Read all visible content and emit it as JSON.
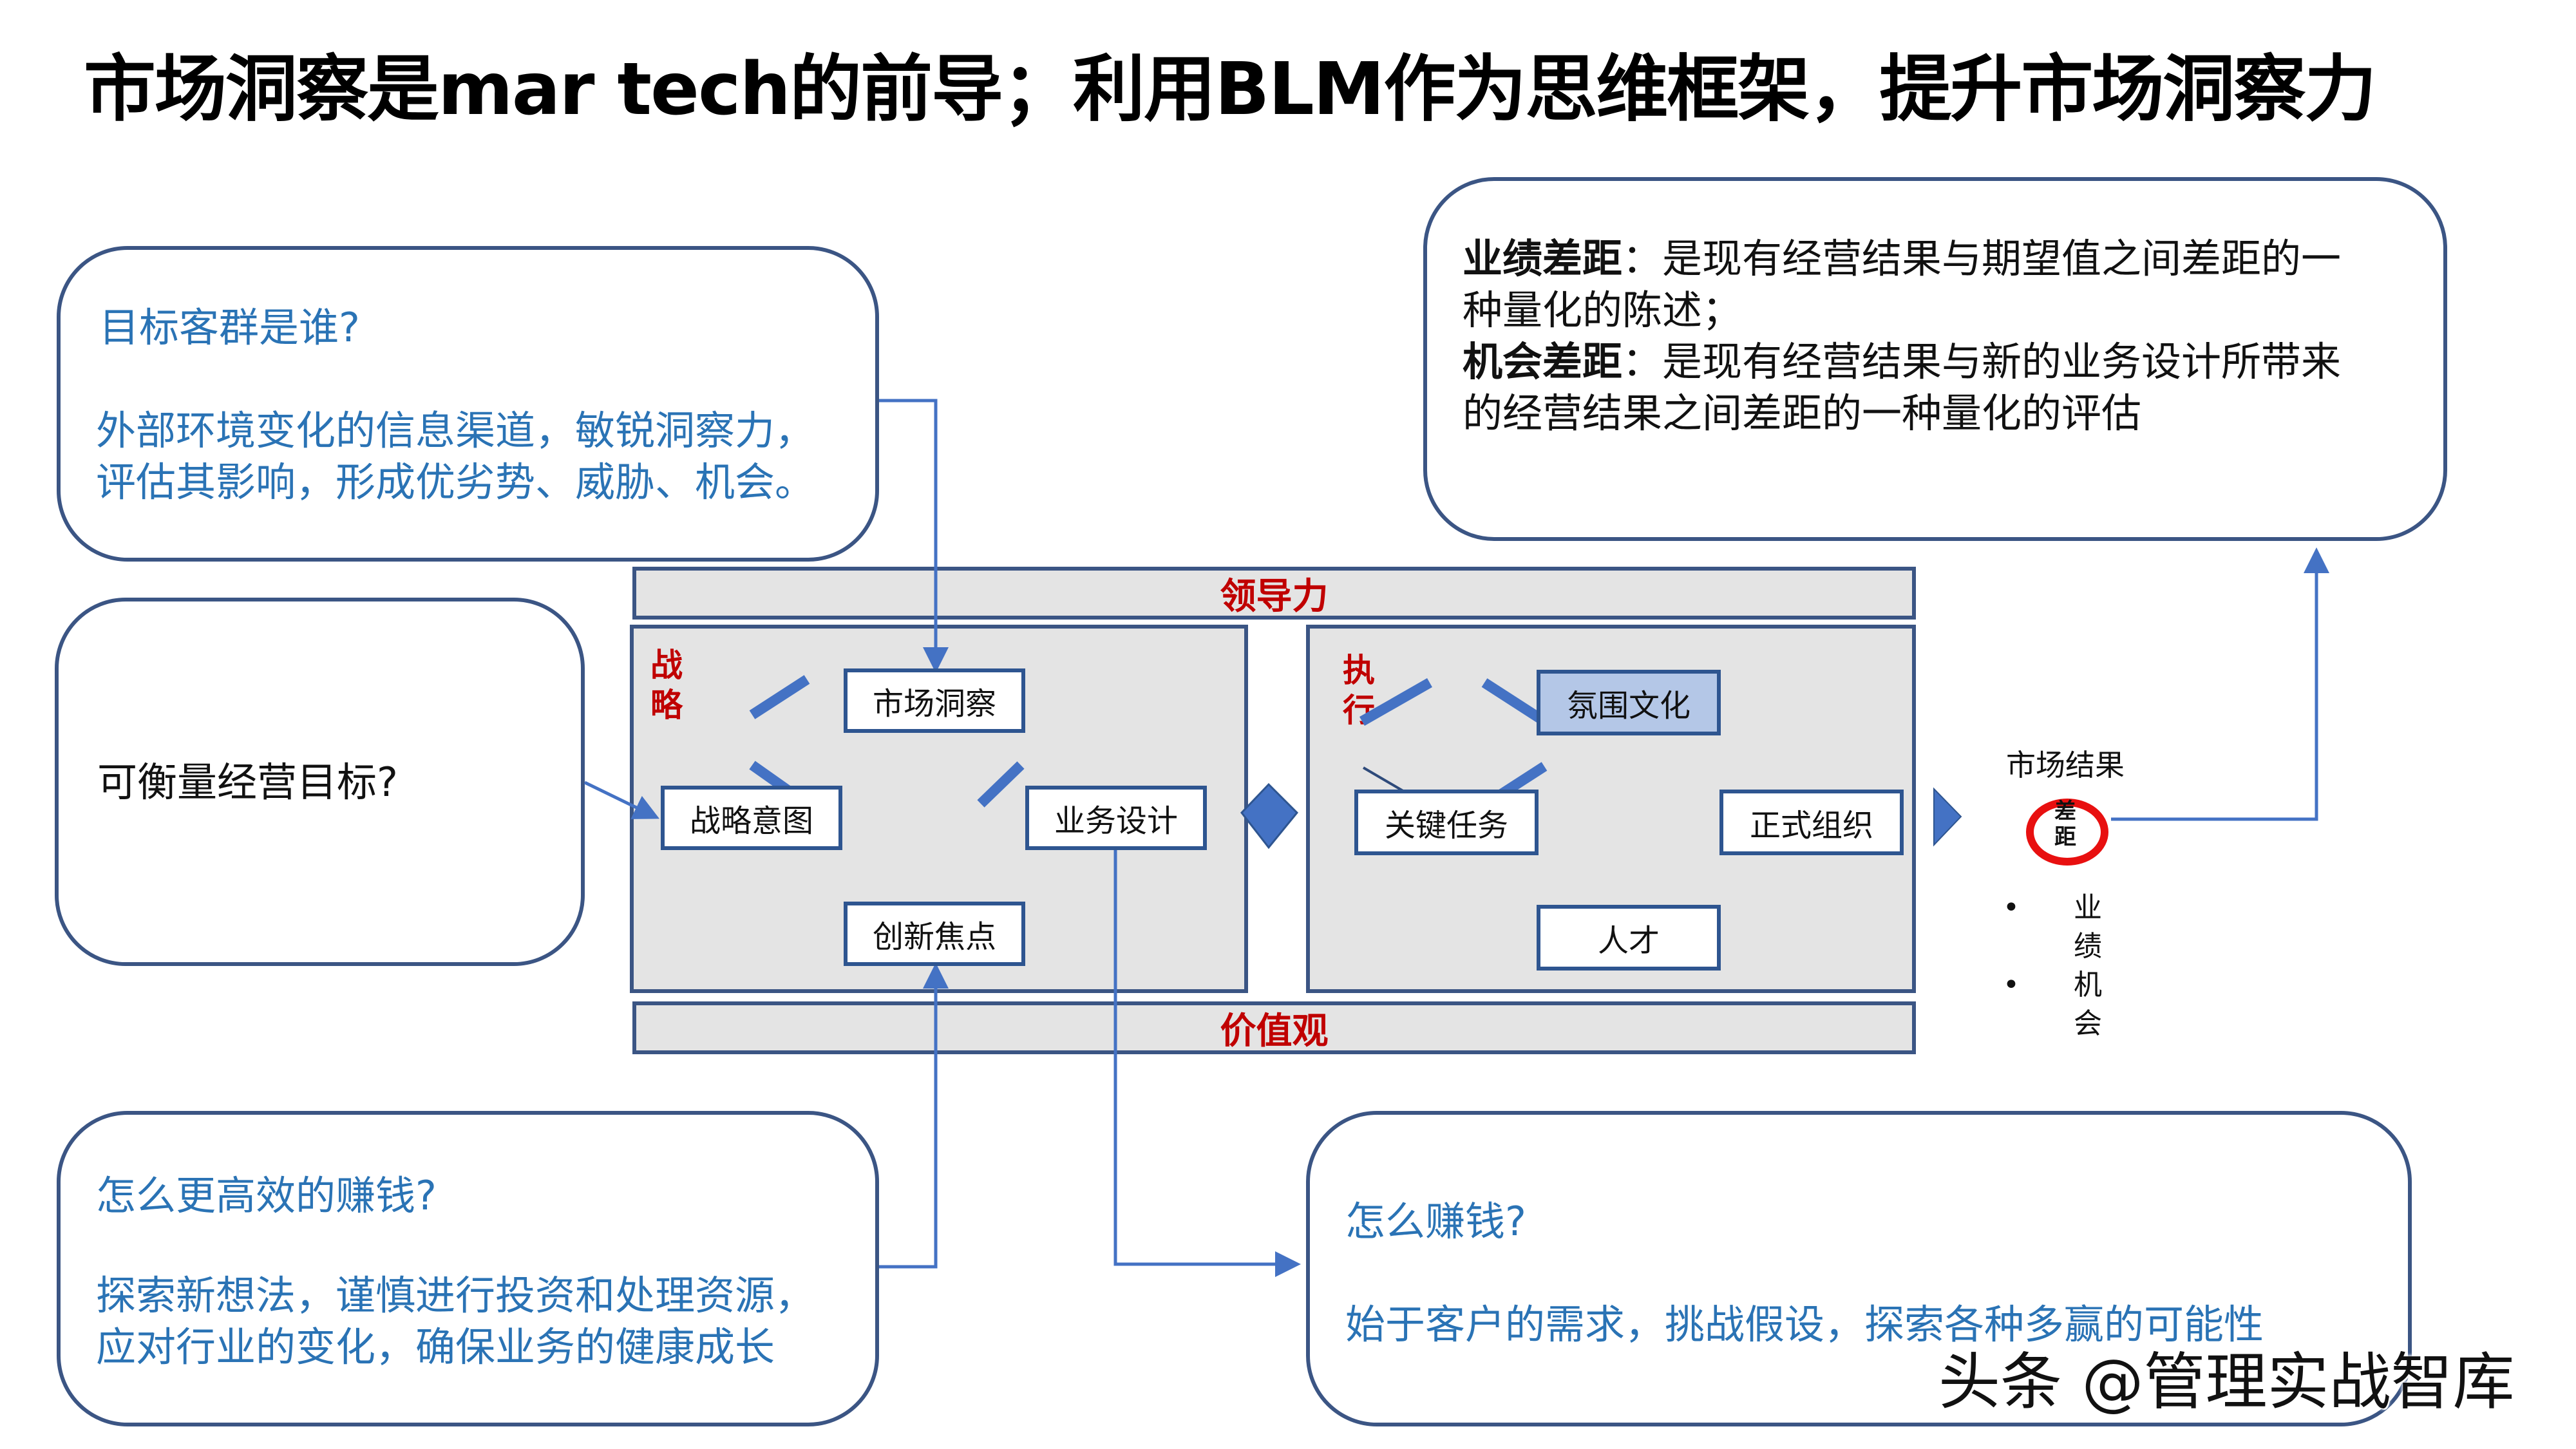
{
  "title": "市场洞察是mar tech的前导；利用BLM作为思维框架，提升市场洞察力",
  "boxes": {
    "target_customers": {
      "question": "目标客群是谁?",
      "lines": [
        "外部环境变化的信息渠道，敏锐洞察力，",
        "评估其影响，形成优劣势、威胁、机会。"
      ]
    },
    "measurable_goal": {
      "question": "可衡量经营目标?"
    },
    "efficient_profit": {
      "question": "怎么更高效的赚钱?",
      "lines": [
        "探索新想法，谨慎进行投资和处理资源，",
        "应对行业的变化，确保业务的健康成长"
      ]
    },
    "how_profit": {
      "question": "怎么赚钱?",
      "lines": [
        "始于客户的需求，挑战假设，探索各种多赢的可能性"
      ]
    },
    "gap_definition": {
      "performance_gap_label": "业绩差距",
      "performance_gap_text_1": "：是现有经营结果与期望值之间差距的一",
      "performance_gap_text_2": "种量化的陈述；",
      "opportunity_gap_label": "机会差距",
      "opportunity_gap_text_1": "：是现有经营结果与新的业务设计所带来",
      "opportunity_gap_text_2": "的经营结果之间差距的一种量化的评估"
    }
  },
  "blm": {
    "leadership_label": "领导力",
    "values_label": "价值观",
    "strategy": {
      "label_chars": [
        "战",
        "略"
      ],
      "nodes": {
        "market_insight": "市场洞察",
        "strategic_intent": "战略意图",
        "business_design": "业务设计",
        "innovation_focus": "创新焦点"
      }
    },
    "execution": {
      "label_chars": [
        "执",
        "行"
      ],
      "nodes": {
        "climate_culture": "氛围文化",
        "critical_tasks": "关键任务",
        "formal_org": "正式组织",
        "talent": "人才"
      }
    }
  },
  "market_result": {
    "label": "市场结果",
    "gap_chars": [
      "差",
      "距"
    ],
    "bullets": [
      {
        "chars": [
          "业",
          "绩"
        ]
      },
      {
        "chars": [
          "机",
          "会"
        ]
      }
    ]
  },
  "watermark": "头条 @管理实战智库",
  "colors": {
    "box_border": "#3b5584",
    "connector": "#4472c4",
    "blue_text": "#2a73b5",
    "label_red": "#c00000",
    "gap_circle": "#e81010",
    "panel_fill": "#e4e4e4",
    "highlight_node": "#b4c7e7"
  }
}
